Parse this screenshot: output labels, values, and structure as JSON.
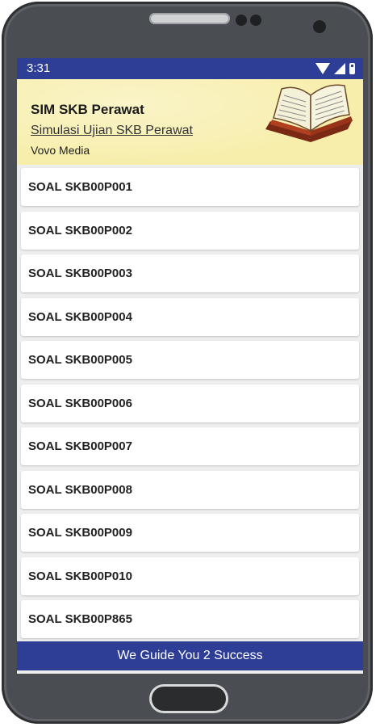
{
  "status_bar": {
    "time": "3:31"
  },
  "header": {
    "title": "SIM SKB Perawat",
    "subtitle": "Simulasi Ujian SKB Perawat",
    "publisher": "Vovo Media"
  },
  "list": {
    "items": [
      {
        "label": "SOAL SKB00P001"
      },
      {
        "label": "SOAL SKB00P002"
      },
      {
        "label": "SOAL SKB00P003"
      },
      {
        "label": "SOAL SKB00P004"
      },
      {
        "label": "SOAL SKB00P005"
      },
      {
        "label": "SOAL SKB00P006"
      },
      {
        "label": "SOAL SKB00P007"
      },
      {
        "label": "SOAL SKB00P008"
      },
      {
        "label": "SOAL SKB00P009"
      },
      {
        "label": "SOAL SKB00P010"
      },
      {
        "label": "SOAL SKB00P865"
      }
    ]
  },
  "footer": {
    "text": "We Guide You 2 Success"
  },
  "colors": {
    "accent": "#2e3e96",
    "header_bg": "#f7eeab",
    "phone_body": "#4a4d52"
  },
  "icons": [
    "wifi-icon",
    "signal-icon",
    "battery-icon",
    "open-book-icon"
  ]
}
